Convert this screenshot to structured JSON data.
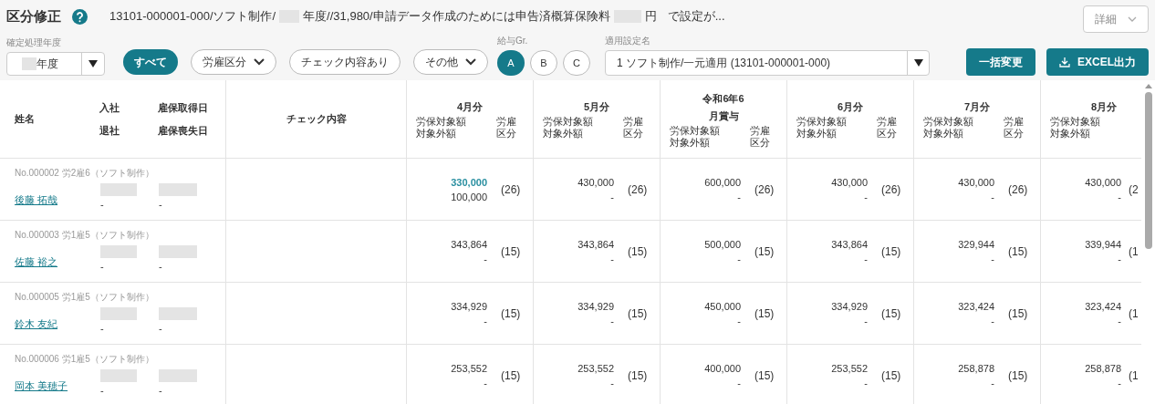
{
  "title": "区分修正",
  "summary": [
    "13101-000001-000/ソフト制作/",
    "年度//31,980/申請データ作成のためには申告済概算保険料",
    "円",
    "で設定が..."
  ],
  "detail_button": "詳細",
  "year_filter": {
    "label": "確定処理年度",
    "value": "年度"
  },
  "filters": [
    {
      "label": "すべて",
      "kind": "toggle",
      "selected": true
    },
    {
      "label": "労雇区分",
      "kind": "dropdown",
      "selected": false
    },
    {
      "label": "チェック内容あり",
      "kind": "toggle",
      "selected": false
    },
    {
      "label": "その他",
      "kind": "dropdown",
      "selected": false
    }
  ],
  "pay_group": {
    "label": "給与Gr.",
    "options": [
      {
        "label": "A",
        "selected": true
      },
      {
        "label": "B",
        "selected": false
      },
      {
        "label": "C",
        "selected": false
      }
    ]
  },
  "setting": {
    "label": "適用設定名",
    "value": "1 ソフト制作/一元適用 (13101-000001-000)"
  },
  "actions": [
    {
      "label": "一括変更",
      "kind": "plain"
    },
    {
      "label": "EXCEL出力",
      "kind": "download"
    }
  ],
  "table": {
    "columns": {
      "name": "姓名",
      "join": "入社",
      "leave": "退社",
      "acquired": "雇保取得日",
      "lost": "雇保喪失日",
      "check": "チェック内容"
    },
    "periods": [
      {
        "title": [
          "4月分"
        ],
        "amount_label": "労保対象額",
        "excluded_label": "対象外額",
        "class_label": "労雇区分"
      },
      {
        "title": [
          "5月分"
        ],
        "amount_label": "労保対象額",
        "excluded_label": "対象外額",
        "class_label": "労雇区分"
      },
      {
        "title": [
          "令和6年6",
          "月賞与"
        ],
        "amount_label": "労保対象額",
        "excluded_label": "対象外額",
        "class_label": "労雇区分"
      },
      {
        "title": [
          "6月分"
        ],
        "amount_label": "労保対象額",
        "excluded_label": "対象外額",
        "class_label": "労雇区分"
      },
      {
        "title": [
          "7月分"
        ],
        "amount_label": "労保対象額",
        "excluded_label": "対象外額",
        "class_label": "労雇区分"
      },
      {
        "title": [
          "8月分"
        ],
        "amount_label": "労保対象額",
        "excluded_label": "対象外額"
      }
    ],
    "rows": [
      {
        "no": "No.000002 労2雇6（ソフト制作）",
        "name": "後藤 拓哉",
        "leave": "-",
        "lost": "-",
        "cells": [
          {
            "amount": "330,000",
            "excluded": "100,000",
            "class": "(26)",
            "highlight": true
          },
          {
            "amount": "430,000",
            "excluded": "-",
            "class": "(26)",
            "highlight": false
          },
          {
            "amount": "600,000",
            "excluded": "-",
            "class": "(26)",
            "highlight": false
          },
          {
            "amount": "430,000",
            "excluded": "-",
            "class": "(26)",
            "highlight": false
          },
          {
            "amount": "430,000",
            "excluded": "-",
            "class": "(26)",
            "highlight": false
          },
          {
            "amount": "430,000",
            "excluded": "-",
            "class": "(2",
            "highlight": false
          }
        ]
      },
      {
        "no": "No.000003 労1雇5（ソフト制作）",
        "name": "佐藤 裕之",
        "leave": "-",
        "lost": "-",
        "cells": [
          {
            "amount": "343,864",
            "excluded": "-",
            "class": "(15)",
            "highlight": false
          },
          {
            "amount": "343,864",
            "excluded": "-",
            "class": "(15)",
            "highlight": false
          },
          {
            "amount": "500,000",
            "excluded": "-",
            "class": "(15)",
            "highlight": false
          },
          {
            "amount": "343,864",
            "excluded": "-",
            "class": "(15)",
            "highlight": false
          },
          {
            "amount": "329,944",
            "excluded": "-",
            "class": "(15)",
            "highlight": false
          },
          {
            "amount": "339,944",
            "excluded": "-",
            "class": "(1",
            "highlight": false
          }
        ]
      },
      {
        "no": "No.000005 労1雇5（ソフト制作）",
        "name": "鈴木 友紀",
        "leave": "-",
        "lost": "-",
        "cells": [
          {
            "amount": "334,929",
            "excluded": "-",
            "class": "(15)",
            "highlight": false
          },
          {
            "amount": "334,929",
            "excluded": "-",
            "class": "(15)",
            "highlight": false
          },
          {
            "amount": "450,000",
            "excluded": "-",
            "class": "(15)",
            "highlight": false
          },
          {
            "amount": "334,929",
            "excluded": "-",
            "class": "(15)",
            "highlight": false
          },
          {
            "amount": "323,424",
            "excluded": "-",
            "class": "(15)",
            "highlight": false
          },
          {
            "amount": "323,424",
            "excluded": "-",
            "class": "(1",
            "highlight": false
          }
        ]
      },
      {
        "no": "No.000006 労1雇5（ソフト制作）",
        "name": "岡本 美穂子",
        "leave": "-",
        "lost": "-",
        "cells": [
          {
            "amount": "253,552",
            "excluded": "-",
            "class": "(15)",
            "highlight": false
          },
          {
            "amount": "253,552",
            "excluded": "-",
            "class": "(15)",
            "highlight": false
          },
          {
            "amount": "400,000",
            "excluded": "-",
            "class": "(15)",
            "highlight": false
          },
          {
            "amount": "253,552",
            "excluded": "-",
            "class": "(15)",
            "highlight": false
          },
          {
            "amount": "258,878",
            "excluded": "-",
            "class": "(15)",
            "highlight": false
          },
          {
            "amount": "258,878",
            "excluded": "-",
            "class": "(1",
            "highlight": false
          }
        ]
      }
    ]
  }
}
